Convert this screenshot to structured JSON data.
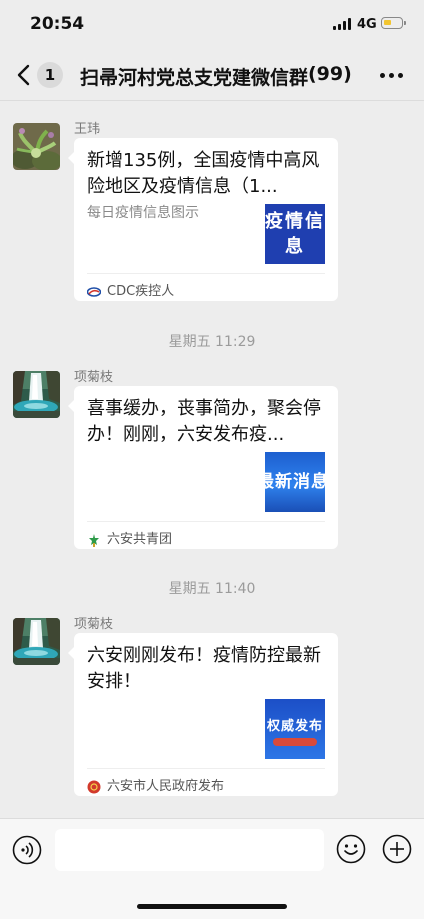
{
  "status_bar": {
    "time": "20:54",
    "network": "4G"
  },
  "nav": {
    "unread": "1",
    "title": "扫帚河村党总支党建微信群",
    "member_count": "(99)"
  },
  "messages": [
    {
      "sender": "王玮",
      "title": "新增135例，全国疫情中高风险地区及疫情信息（1...",
      "description": "每日疫情信息图示",
      "thumbnail_text": "疫情信息",
      "source": "CDC疾控人",
      "avatar_icon": "plant-avatar-icon",
      "source_icon": "cdc-logo-icon"
    },
    {
      "timestamp": "星期五 11:29",
      "sender": "项菊枝",
      "title": "喜事缓办，丧事简办，聚会停办！刚刚，六安发布疫...",
      "thumbnail_text": "最新消息",
      "source": "六安共青团",
      "avatar_icon": "waterfall-avatar-icon",
      "source_icon": "youth-league-logo-icon"
    },
    {
      "timestamp": "星期五 11:40",
      "sender": "项菊枝",
      "title": "六安刚刚发布！疫情防控最新安排！",
      "thumbnail_text": "权威发布",
      "source": "六安市人民政府发布",
      "avatar_icon": "waterfall-avatar-icon",
      "source_icon": "government-logo-icon"
    }
  ],
  "input": {
    "value": ""
  },
  "colors": {
    "background": "#ededed",
    "card": "#ffffff",
    "thumb_blue": "#1f3fb0",
    "battery": "#f2c530"
  }
}
